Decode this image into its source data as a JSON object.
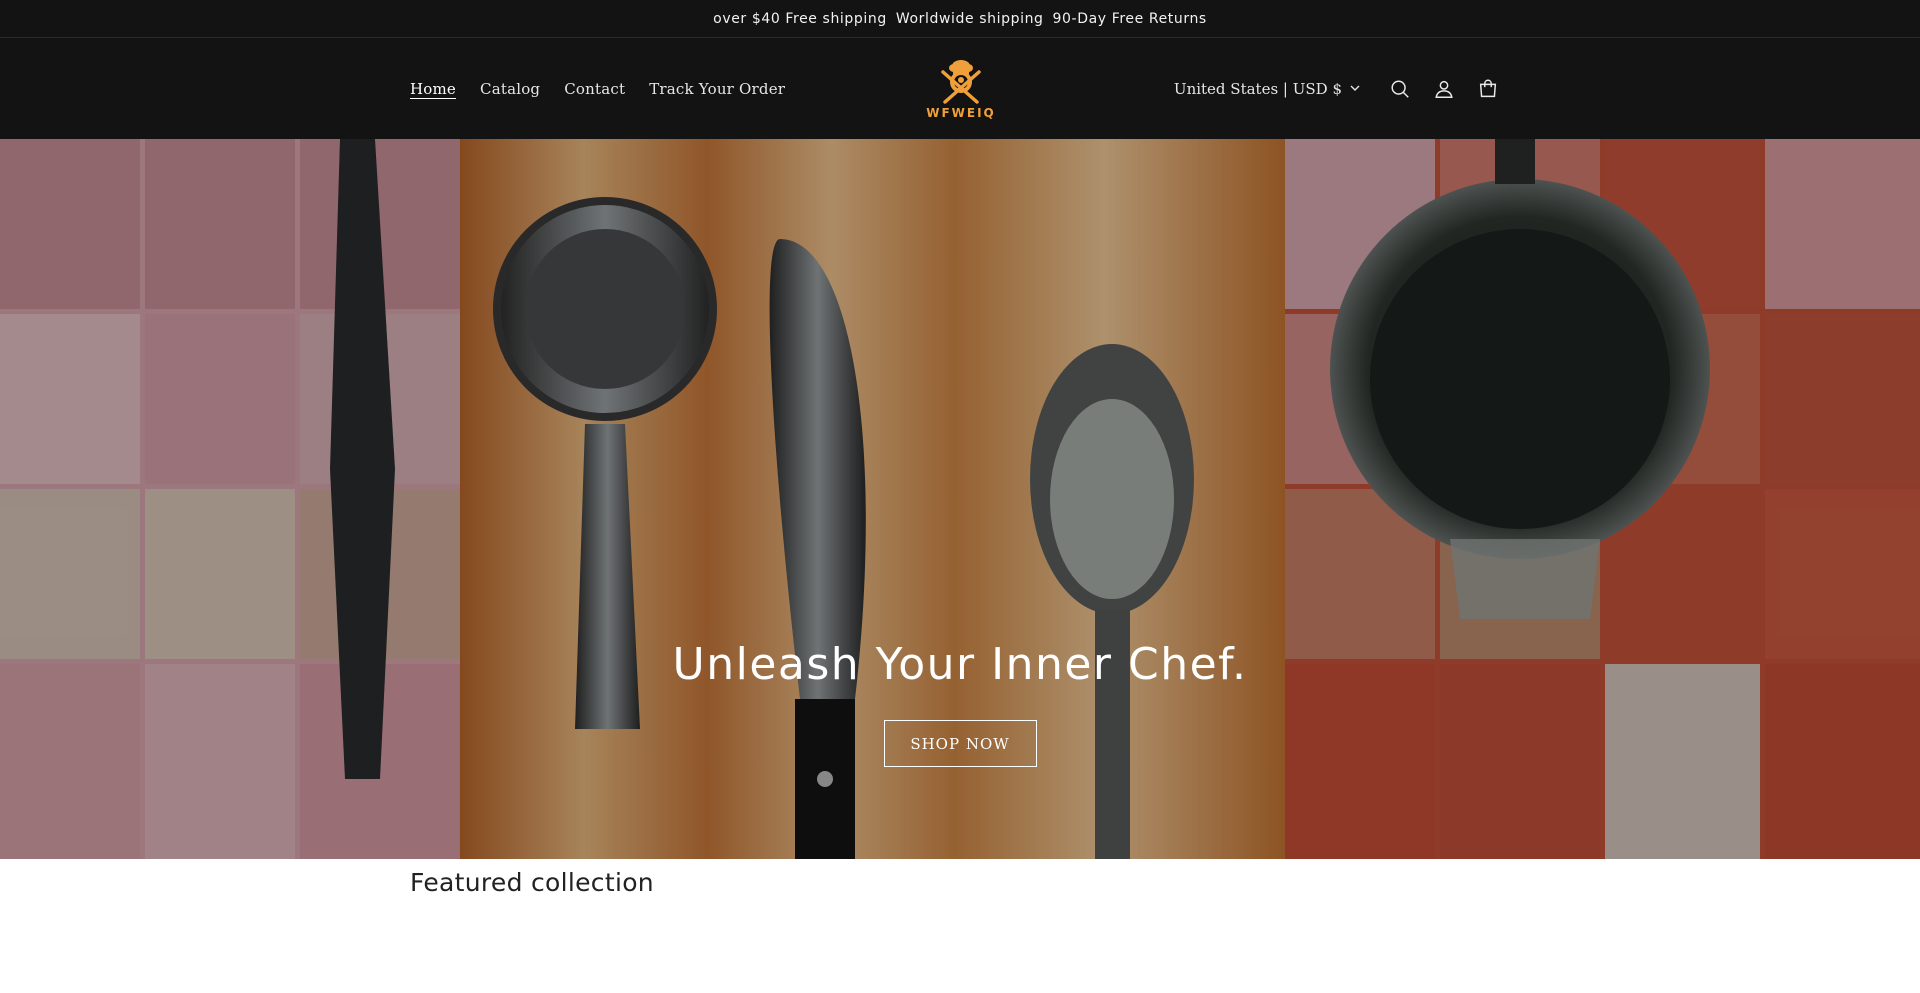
{
  "announcement": {
    "items": [
      "over $40 Free shipping",
      "Worldwide shipping",
      "90-Day Free Returns"
    ]
  },
  "header": {
    "nav": [
      "Home",
      "Catalog",
      "Contact",
      "Track Your Order"
    ],
    "logo_text": "WFWEIQ",
    "country_selector": "United States | USD $",
    "icons": [
      "search-icon",
      "account-icon",
      "cart-icon"
    ]
  },
  "hero": {
    "title": "Unleash Your Inner Chef.",
    "button": "SHOP NOW"
  },
  "featured": {
    "title": "Featured collection"
  },
  "colors": {
    "header_bg": "#131313",
    "logo_accent": "#f0a03a",
    "hero_text": "#ffffff"
  }
}
